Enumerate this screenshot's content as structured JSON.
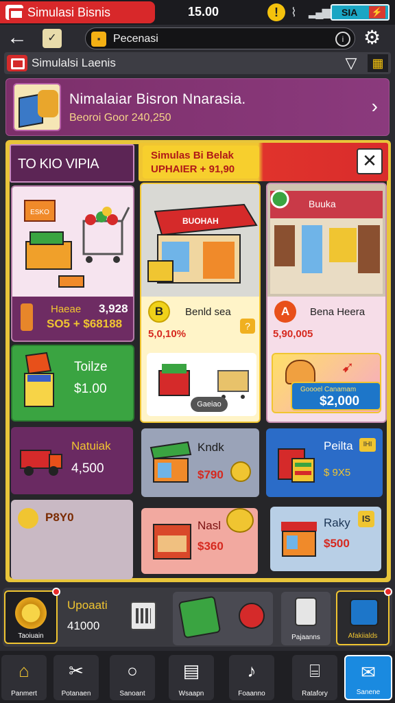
{
  "status_bar": {
    "app_title": "Simulasi Bisnis",
    "time": "15.00",
    "battery_text": "SIA",
    "warning_icon": "warning-icon",
    "colors": {
      "tab": "#d8282a",
      "battery": "#1aa6c4"
    }
  },
  "browser_bar": {
    "url": "Pecenasi"
  },
  "app_nav": {
    "title": "Simulalsi Laenis"
  },
  "banner": {
    "headline": "Nimalaiar Bisron Nnarasia.",
    "subline": "Beoroi Goor 240,250"
  },
  "panel": {
    "section_title": "TO KIO VIPIA",
    "strip_line1": "Simulas Bi Belak",
    "strip_line2": "UPHAIER + 91,90",
    "accent_color": "#e8c53a"
  },
  "cards": {
    "cart": {
      "art_label": "ESKO",
      "key": "Haeae",
      "value1": "3,928",
      "value2": "SO5 + $68188"
    },
    "toilet": {
      "label": "Toilze",
      "price": "$1.00"
    },
    "truck": {
      "label": "Natuiak",
      "price": "4,500"
    },
    "grey": {
      "label": "P8Y0"
    },
    "shop1": {
      "sign": "BUOHAH",
      "badge": "B",
      "name": "Benld sea",
      "price": "5,0,10%",
      "pill": "Gaeiao"
    },
    "shop2": {
      "sign": "Buuka",
      "badge": "A",
      "name": "Bena Heera",
      "price": "5,90,005",
      "cta_small": "Goooel Canamam",
      "cta_big": "$2,000"
    },
    "kiosk": {
      "line1": "Kndk",
      "line2": "$790"
    },
    "pelita": {
      "line1": "Peilta",
      "line2": "$ 9X5",
      "tag": "IHI"
    },
    "nasi": {
      "line1": "Nasl",
      "line2": "$360"
    },
    "raky": {
      "line1": "Raky",
      "line2": "$500",
      "tag": "IS"
    }
  },
  "action_bar": {
    "upgrade_icon_label": "Taoiuain",
    "upgrade_title": "Upoaati",
    "upgrade_value": "41000",
    "phone_label": "Pajaanns",
    "achievements_label": "Afakiialds"
  },
  "bottom_nav": [
    {
      "label": "Panmert",
      "icon": "home-icon"
    },
    {
      "label": "Potanaen",
      "icon": "tools-icon"
    },
    {
      "label": "Sanoant",
      "icon": "search-icon"
    },
    {
      "label": "Wsaapn",
      "icon": "grid-icon"
    },
    {
      "label": "Foaanno",
      "icon": "note-icon"
    },
    {
      "label": "Ratafory",
      "icon": "bank-icon"
    },
    {
      "label": "Sanene",
      "icon": "mail-icon"
    }
  ]
}
